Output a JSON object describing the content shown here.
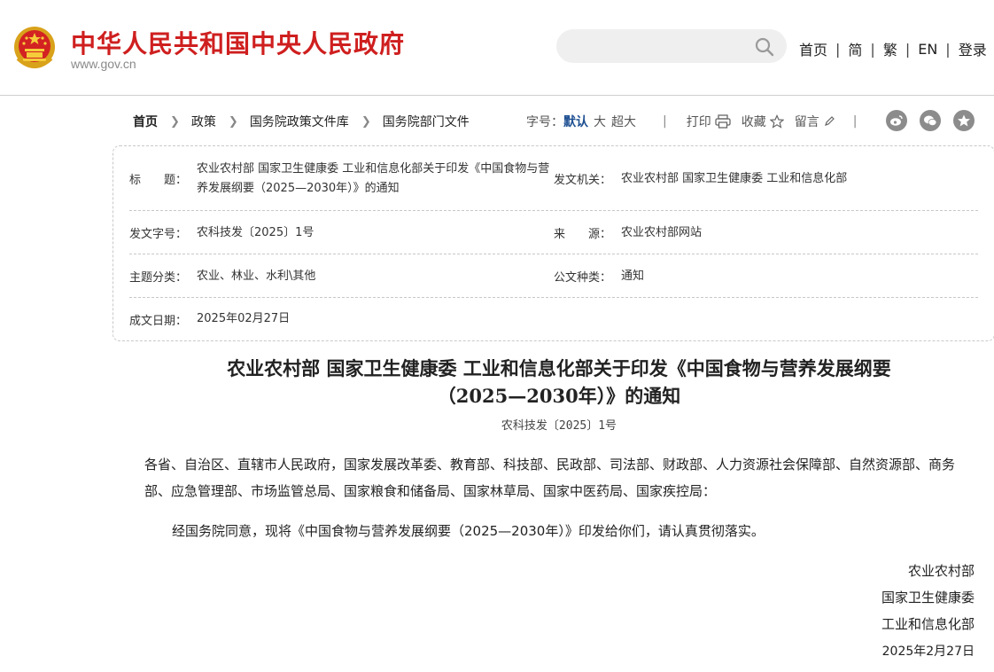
{
  "header": {
    "site_title": "中华人民共和国中央人民政府",
    "site_domain": "www.gov.cn",
    "search_placeholder": "",
    "nav": [
      "首页",
      "简",
      "繁",
      "EN",
      "登录"
    ]
  },
  "breadcrumb": [
    "首页",
    "政策",
    "国务院政策文件库",
    "国务院部门文件"
  ],
  "toolbar": {
    "font_size_label": "字号：",
    "font_sizes": [
      "默认",
      "大",
      "超大"
    ],
    "divider": "|",
    "print_label": "打印",
    "favorite_label": "收藏",
    "comment_label": "留言"
  },
  "info": {
    "title_label": "标　　题：",
    "title_value": "农业农村部 国家卫生健康委 工业和信息化部关于印发《中国食物与营养发展纲要（2025—2030年）》的通知",
    "issuer_label": "发文机关：",
    "issuer_value": "农业农村部 国家卫生健康委 工业和信息化部",
    "docno_label": "发文字号：",
    "docno_value": "农科技发〔2025〕1号",
    "source_label": "来　　源：",
    "source_value": "农业农村部网站",
    "topic_label": "主题分类：",
    "topic_value": "农业、林业、水利\\其他",
    "type_label": "公文种类：",
    "type_value": "通知",
    "date_label": "成文日期：",
    "date_value": "2025年02月27日"
  },
  "article": {
    "title_line1": "农业农村部 国家卫生健康委 工业和信息化部关于印发《中国食物与营养发展纲要",
    "title_line2": "（2025—2030年）》的通知",
    "doc_number": "农科技发〔2025〕1号",
    "recipients": "各省、自治区、直辖市人民政府，国家发展改革委、教育部、科技部、民政部、司法部、财政部、人力资源社会保障部、自然资源部、商务部、应急管理部、市场监管总局、国家粮食和储备局、国家林草局、国家中医药局、国家疾控局：",
    "body": "经国务院同意，现将《中国食物与营养发展纲要（2025—2030年）》印发给你们，请认真贯彻落实。",
    "signatures": [
      "农业农村部",
      "国家卫生健康委",
      "工业和信息化部",
      "2025年2月27日"
    ]
  },
  "colors": {
    "brand_red": "#cf1f1f",
    "active_blue": "#1d4f91",
    "share_gray": "#8c8c8c"
  }
}
